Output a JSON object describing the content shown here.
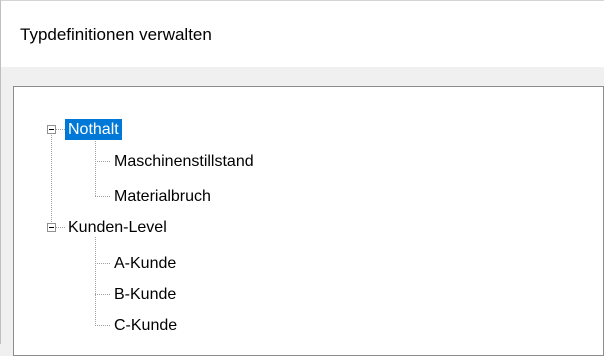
{
  "window": {
    "title": "Typdefinitionen verwalten"
  },
  "tree": {
    "nodes": [
      {
        "label": "Nothalt",
        "expanded": true,
        "selected": true,
        "children": [
          {
            "label": "Maschinenstillstand"
          },
          {
            "label": "Materialbruch"
          }
        ]
      },
      {
        "label": "Kunden-Level",
        "expanded": true,
        "selected": false,
        "children": [
          {
            "label": "A-Kunde"
          },
          {
            "label": "B-Kunde"
          },
          {
            "label": "C-Kunde"
          }
        ]
      }
    ]
  },
  "colors": {
    "selection": "#0078d7",
    "tree_lines": "#a0a0a0"
  }
}
